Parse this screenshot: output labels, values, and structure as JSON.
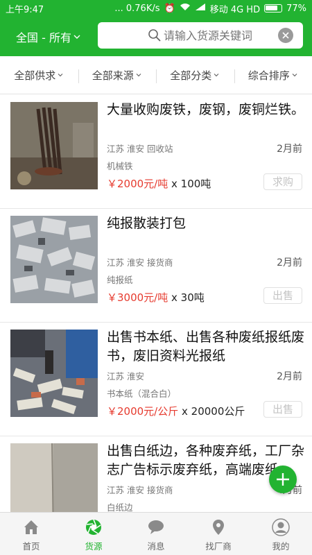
{
  "status_bar": {
    "time": "上午9:47",
    "indicators": "... 0.76K/s",
    "carrier": "移动 4G HD",
    "battery": "77%"
  },
  "header": {
    "region": "全国 - 所有",
    "search_placeholder": "请输入货源关键词"
  },
  "filters": [
    {
      "label": "全部供求"
    },
    {
      "label": "全部来源"
    },
    {
      "label": "全部分类"
    },
    {
      "label": "综合排序"
    }
  ],
  "listings": [
    {
      "title": "大量收购废铁，废钢，废铜烂铁。",
      "location": "江苏 淮安 回收站",
      "time": "2月前",
      "category": "机械铁",
      "price": "￥2000元/吨",
      "quantity": " x 100吨",
      "action": "求购"
    },
    {
      "title": "纯报散装打包",
      "location": "江苏 淮安 接货商",
      "time": "2月前",
      "category": "纯报纸",
      "price": "￥3000元/吨",
      "quantity": " x 30吨",
      "action": "出售"
    },
    {
      "title": "出售书本纸、出售各种废纸报纸废书，废旧资料光报纸",
      "location": "江苏 淮安",
      "time": "2月前",
      "category": "书本纸（混合白）",
      "price": "￥2000元/公斤",
      "quantity": " x 20000公斤",
      "action": "出售"
    },
    {
      "title": "出售白纸边，各种废弃纸，工厂杂志广告标示废弃纸，高端废纸",
      "location": "江苏 淮安 接货商",
      "time": "4月前",
      "category": "白纸边",
      "price": "",
      "quantity": "",
      "action": ""
    }
  ],
  "tabs": [
    {
      "label": "首页",
      "icon": "home-icon"
    },
    {
      "label": "货源",
      "icon": "aperture-icon"
    },
    {
      "label": "消息",
      "icon": "message-icon"
    },
    {
      "label": "找厂商",
      "icon": "location-pin-icon"
    },
    {
      "label": "我的",
      "icon": "user-icon"
    }
  ],
  "colors": {
    "brand": "#22b331",
    "price": "#e63a2e"
  }
}
